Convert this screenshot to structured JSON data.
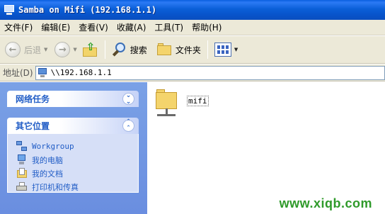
{
  "window": {
    "title": "Samba on Mifi (192.168.1.1)"
  },
  "menu": [
    "文件(F)",
    "编辑(E)",
    "查看(V)",
    "收藏(A)",
    "工具(T)",
    "帮助(H)"
  ],
  "toolbar": {
    "back_label": "后退",
    "search_label": "搜索",
    "folders_label": "文件夹"
  },
  "address": {
    "label": "地址(D)",
    "value": "\\\\192.168.1.1"
  },
  "taskpane": {
    "network_tasks": {
      "title": "网络任务"
    },
    "other_places": {
      "title": "其它位置",
      "items": [
        {
          "label": "Workgroup",
          "icon": "network-icon"
        },
        {
          "label": "我的电脑",
          "icon": "computer-icon"
        },
        {
          "label": "我的文档",
          "icon": "documents-icon"
        },
        {
          "label": "打印机和传真",
          "icon": "printer-icon"
        }
      ]
    }
  },
  "content": {
    "items": [
      {
        "label": "mifi",
        "icon": "shared-folder-icon"
      }
    ]
  },
  "watermark": "www.xiqb.com",
  "colors": {
    "titlebar": "#0a5fd8",
    "taskpane": "#7aa1e6",
    "link": "#215dc6",
    "watermark": "#2f9a2a"
  }
}
